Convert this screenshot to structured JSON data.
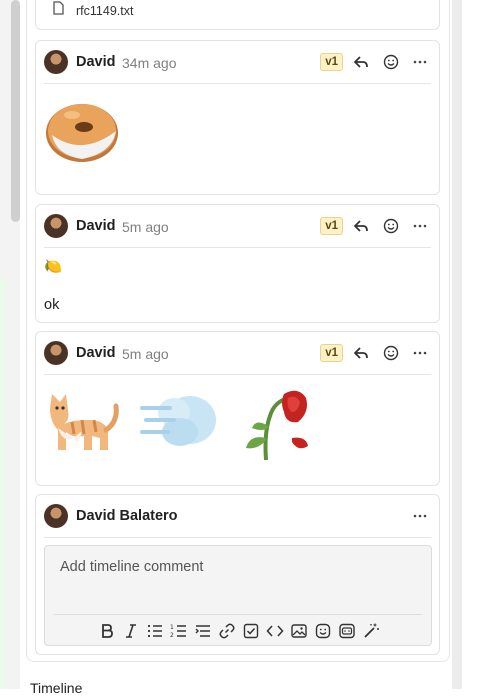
{
  "attachment": {
    "file_name": "rfc1149.txt"
  },
  "comments": [
    {
      "author": "David",
      "time": "34m ago",
      "version": "v1",
      "reactions": [
        "bagel"
      ]
    },
    {
      "author": "David",
      "time": "5m ago",
      "version": "v1",
      "emoji": "🍋",
      "text": "ok"
    },
    {
      "author": "David",
      "time": "5m ago",
      "version": "v1",
      "reactions": [
        "cat",
        "wind",
        "wilted-rose"
      ]
    }
  ],
  "composer": {
    "author": "David Balatero",
    "placeholder": "Add timeline comment",
    "toolbar": [
      "bold",
      "italic",
      "bulleted-list",
      "numbered-list",
      "indent-list",
      "link",
      "task-list",
      "code",
      "image",
      "emoji",
      "sticker",
      "magic-wand"
    ]
  },
  "footer": {
    "timeline_label": "Timeline"
  },
  "colors": {
    "badge_bg": "#fdf1c7",
    "composer_bg": "#f4f4f4",
    "border": "#e3e3e3"
  }
}
